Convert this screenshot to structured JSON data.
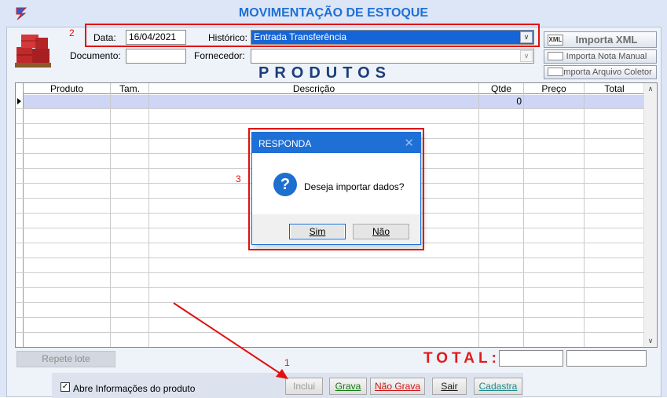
{
  "window": {
    "title": "MOVIMENTAÇÃO DE ESTOQUE"
  },
  "form": {
    "data_label": "Data:",
    "data_value": "16/04/2021",
    "historico_label": "Histórico:",
    "historico_value": "Entrada Transferência",
    "documento_label": "Documento:",
    "documento_value": "",
    "fornecedor_label": "Fornecedor:",
    "fornecedor_value": ""
  },
  "side_buttons": {
    "importa_xml": "Importa XML",
    "importa_nota_manual": "Importa Nota Manual",
    "importa_arquivo_coletor": "Importa Arquivo Coletor",
    "xml_icon_text": "XML"
  },
  "grid": {
    "heading": "PRODUTOS",
    "columns": [
      "Produto",
      "Tam.",
      "Descrição",
      "Qtde",
      "Preço",
      "Total"
    ],
    "first_row_qtde": "0"
  },
  "footer": {
    "repete_lote": "Repete lote",
    "total_label": "TOTAL:",
    "abre_informacoes": "Abre Informações do produto",
    "buttons": {
      "inclui": "Inclui",
      "grava": "Grava",
      "nao_grava": "Não Grava",
      "sair": "Sair",
      "cadastra": "Cadastra"
    }
  },
  "dialog": {
    "title": "RESPONDA",
    "message": "Deseja importar dados?",
    "sim": "Sim",
    "nao": "Não"
  },
  "annotations": {
    "step1": "1",
    "step2": "2",
    "step3": "3"
  },
  "colors": {
    "title": "#1f6fd6",
    "total": "#e01b1b",
    "annotation": "#e01010",
    "selection": "#1565d8"
  }
}
